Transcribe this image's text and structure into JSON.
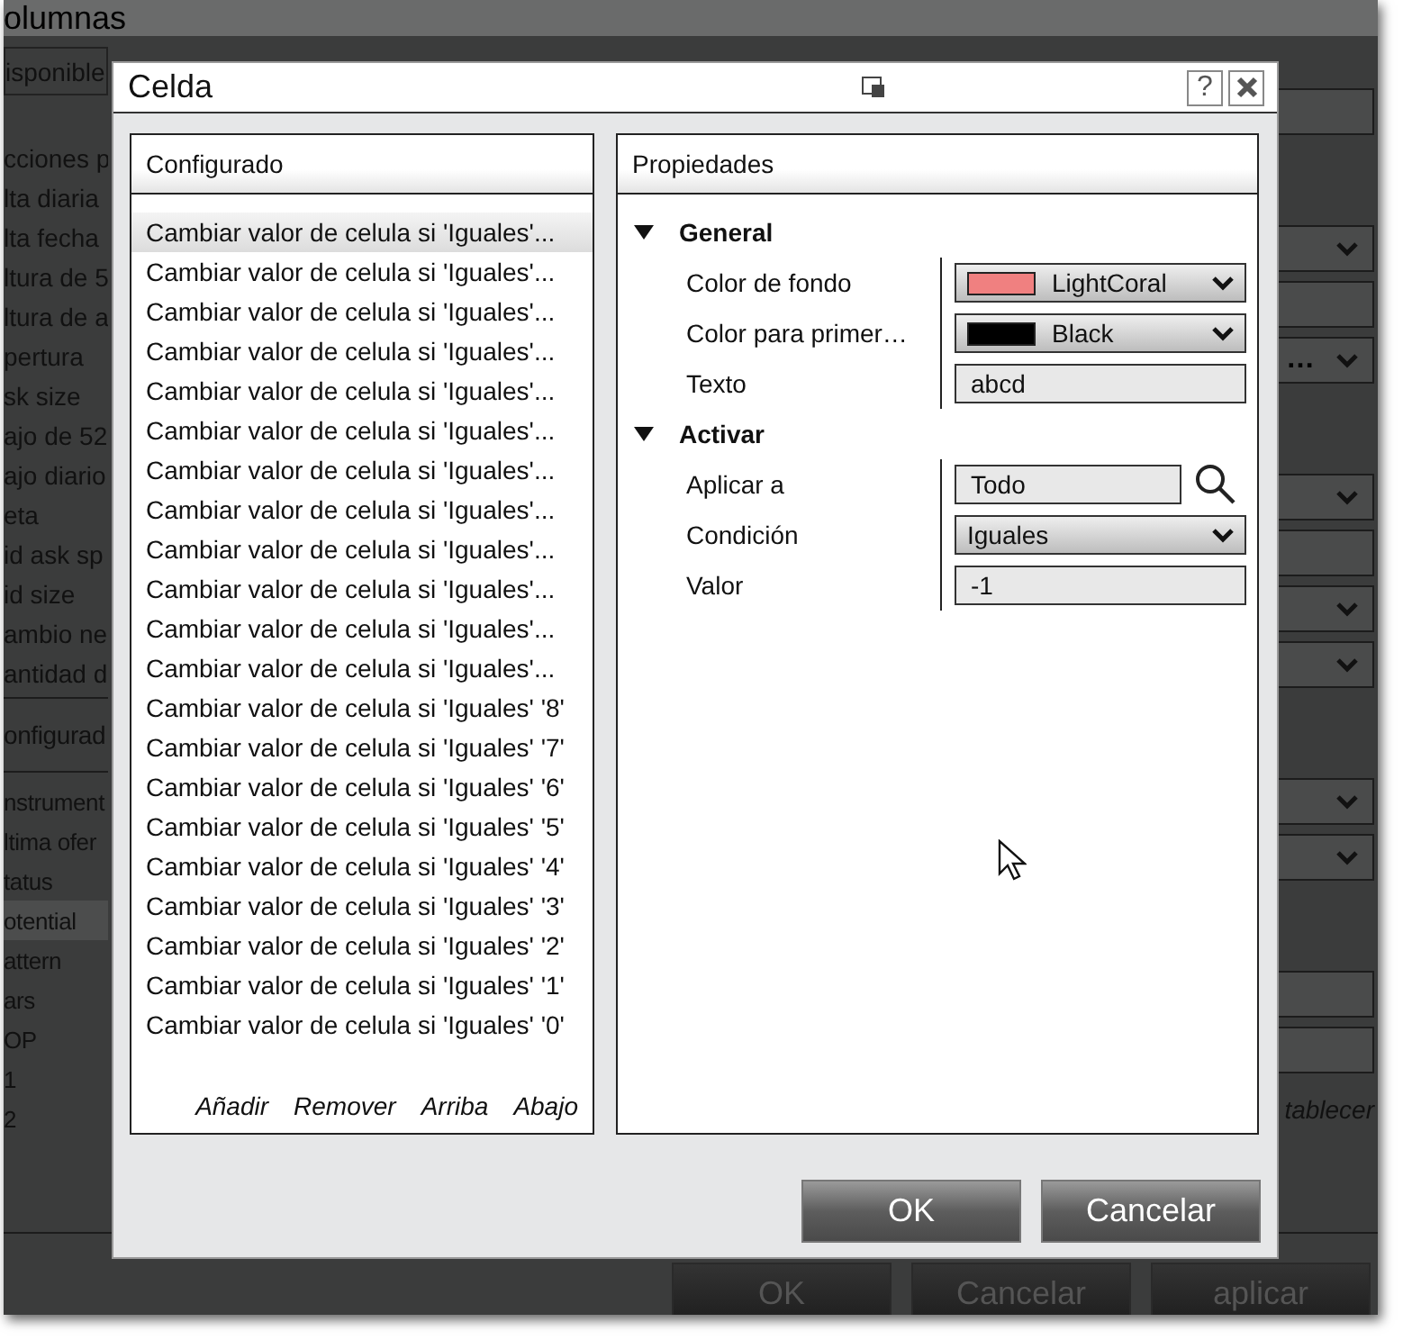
{
  "background_window": {
    "title": "olumnas",
    "dropdown_label": "isponible",
    "available_items": [
      "cciones p",
      "lta diaria",
      "lta fecha",
      "ltura de 5",
      "ltura de a",
      "pertura",
      "sk size",
      "ajo de 52",
      "ajo diario",
      "eta",
      "id ask sp",
      "id size",
      "ambio ne",
      "antidad d"
    ],
    "configured_header": "onfigurad",
    "configured_items": [
      {
        "label": "nstrument",
        "selected": false
      },
      {
        "label": "ltima ofer",
        "selected": false
      },
      {
        "label": "tatus",
        "selected": false
      },
      {
        "label": "otential",
        "selected": true
      },
      {
        "label": "attern",
        "selected": false
      },
      {
        "label": "ars",
        "selected": false
      },
      {
        "label": "OP",
        "selected": false
      },
      {
        "label": "1",
        "selected": false
      },
      {
        "label": "2",
        "selected": false
      }
    ],
    "right_groups": [
      [
        {
          "kind": "field"
        }
      ],
      [
        {
          "kind": "dropdown"
        },
        {
          "kind": "field"
        },
        {
          "kind": "dropdown",
          "value": "…"
        }
      ],
      [
        {
          "kind": "dropdown"
        },
        {
          "kind": "field"
        },
        {
          "kind": "dropdown"
        },
        {
          "kind": "dropdown"
        }
      ],
      [
        {
          "kind": "dropdown"
        },
        {
          "kind": "dropdown"
        }
      ],
      [
        {
          "kind": "field"
        },
        {
          "kind": "field"
        }
      ]
    ],
    "restore_link": "tablecer",
    "buttons": [
      "OK",
      "Cancelar",
      "aplicar"
    ]
  },
  "dialog": {
    "title": "Celda",
    "help": "?",
    "configured": {
      "header": "Configurado",
      "items": [
        {
          "label": "Cambiar valor de celula si 'Iguales'...",
          "selected": true
        },
        {
          "label": "Cambiar valor de celula si 'Iguales'...",
          "selected": false
        },
        {
          "label": "Cambiar valor de celula si 'Iguales'...",
          "selected": false
        },
        {
          "label": "Cambiar valor de celula si 'Iguales'...",
          "selected": false
        },
        {
          "label": "Cambiar valor de celula si 'Iguales'...",
          "selected": false
        },
        {
          "label": "Cambiar valor de celula si 'Iguales'...",
          "selected": false
        },
        {
          "label": "Cambiar valor de celula si 'Iguales'...",
          "selected": false
        },
        {
          "label": "Cambiar valor de celula si 'Iguales'...",
          "selected": false
        },
        {
          "label": "Cambiar valor de celula si 'Iguales'...",
          "selected": false
        },
        {
          "label": "Cambiar valor de celula si 'Iguales'...",
          "selected": false
        },
        {
          "label": "Cambiar valor de celula si 'Iguales'...",
          "selected": false
        },
        {
          "label": "Cambiar valor de celula si 'Iguales'...",
          "selected": false
        },
        {
          "label": "Cambiar valor de celula si 'Iguales' '8'",
          "selected": false
        },
        {
          "label": "Cambiar valor de celula si 'Iguales' '7'",
          "selected": false
        },
        {
          "label": "Cambiar valor de celula si 'Iguales' '6'",
          "selected": false
        },
        {
          "label": "Cambiar valor de celula si 'Iguales' '5'",
          "selected": false
        },
        {
          "label": "Cambiar valor de celula si 'Iguales' '4'",
          "selected": false
        },
        {
          "label": "Cambiar valor de celula si 'Iguales' '3'",
          "selected": false
        },
        {
          "label": "Cambiar valor de celula si 'Iguales' '2'",
          "selected": false
        },
        {
          "label": "Cambiar valor de celula si 'Iguales' '1'",
          "selected": false
        },
        {
          "label": "Cambiar valor de celula si 'Iguales' '0'",
          "selected": false
        }
      ],
      "actions": [
        "Añadir",
        "Remover",
        "Arriba",
        "Abajo"
      ]
    },
    "properties": {
      "header": "Propiedades",
      "sections": [
        {
          "title": "General",
          "expanded": true,
          "rows": [
            {
              "label": "Color de fondo",
              "kind": "color_dropdown",
              "value": "LightCoral",
              "color": "#f08080"
            },
            {
              "label": "Color para primer…",
              "kind": "color_dropdown",
              "value": "Black",
              "color": "#000000"
            },
            {
              "label": "Texto",
              "kind": "text_field",
              "value": "abcd"
            }
          ]
        },
        {
          "title": "Activar",
          "expanded": true,
          "rows": [
            {
              "label": "Aplicar a",
              "kind": "search_field",
              "value": "Todo"
            },
            {
              "label": "Condición",
              "kind": "dropdown",
              "value": "Iguales"
            },
            {
              "label": "Valor",
              "kind": "text_field",
              "value": "-1"
            }
          ]
        }
      ]
    },
    "buttons": [
      "OK",
      "Cancelar"
    ]
  }
}
